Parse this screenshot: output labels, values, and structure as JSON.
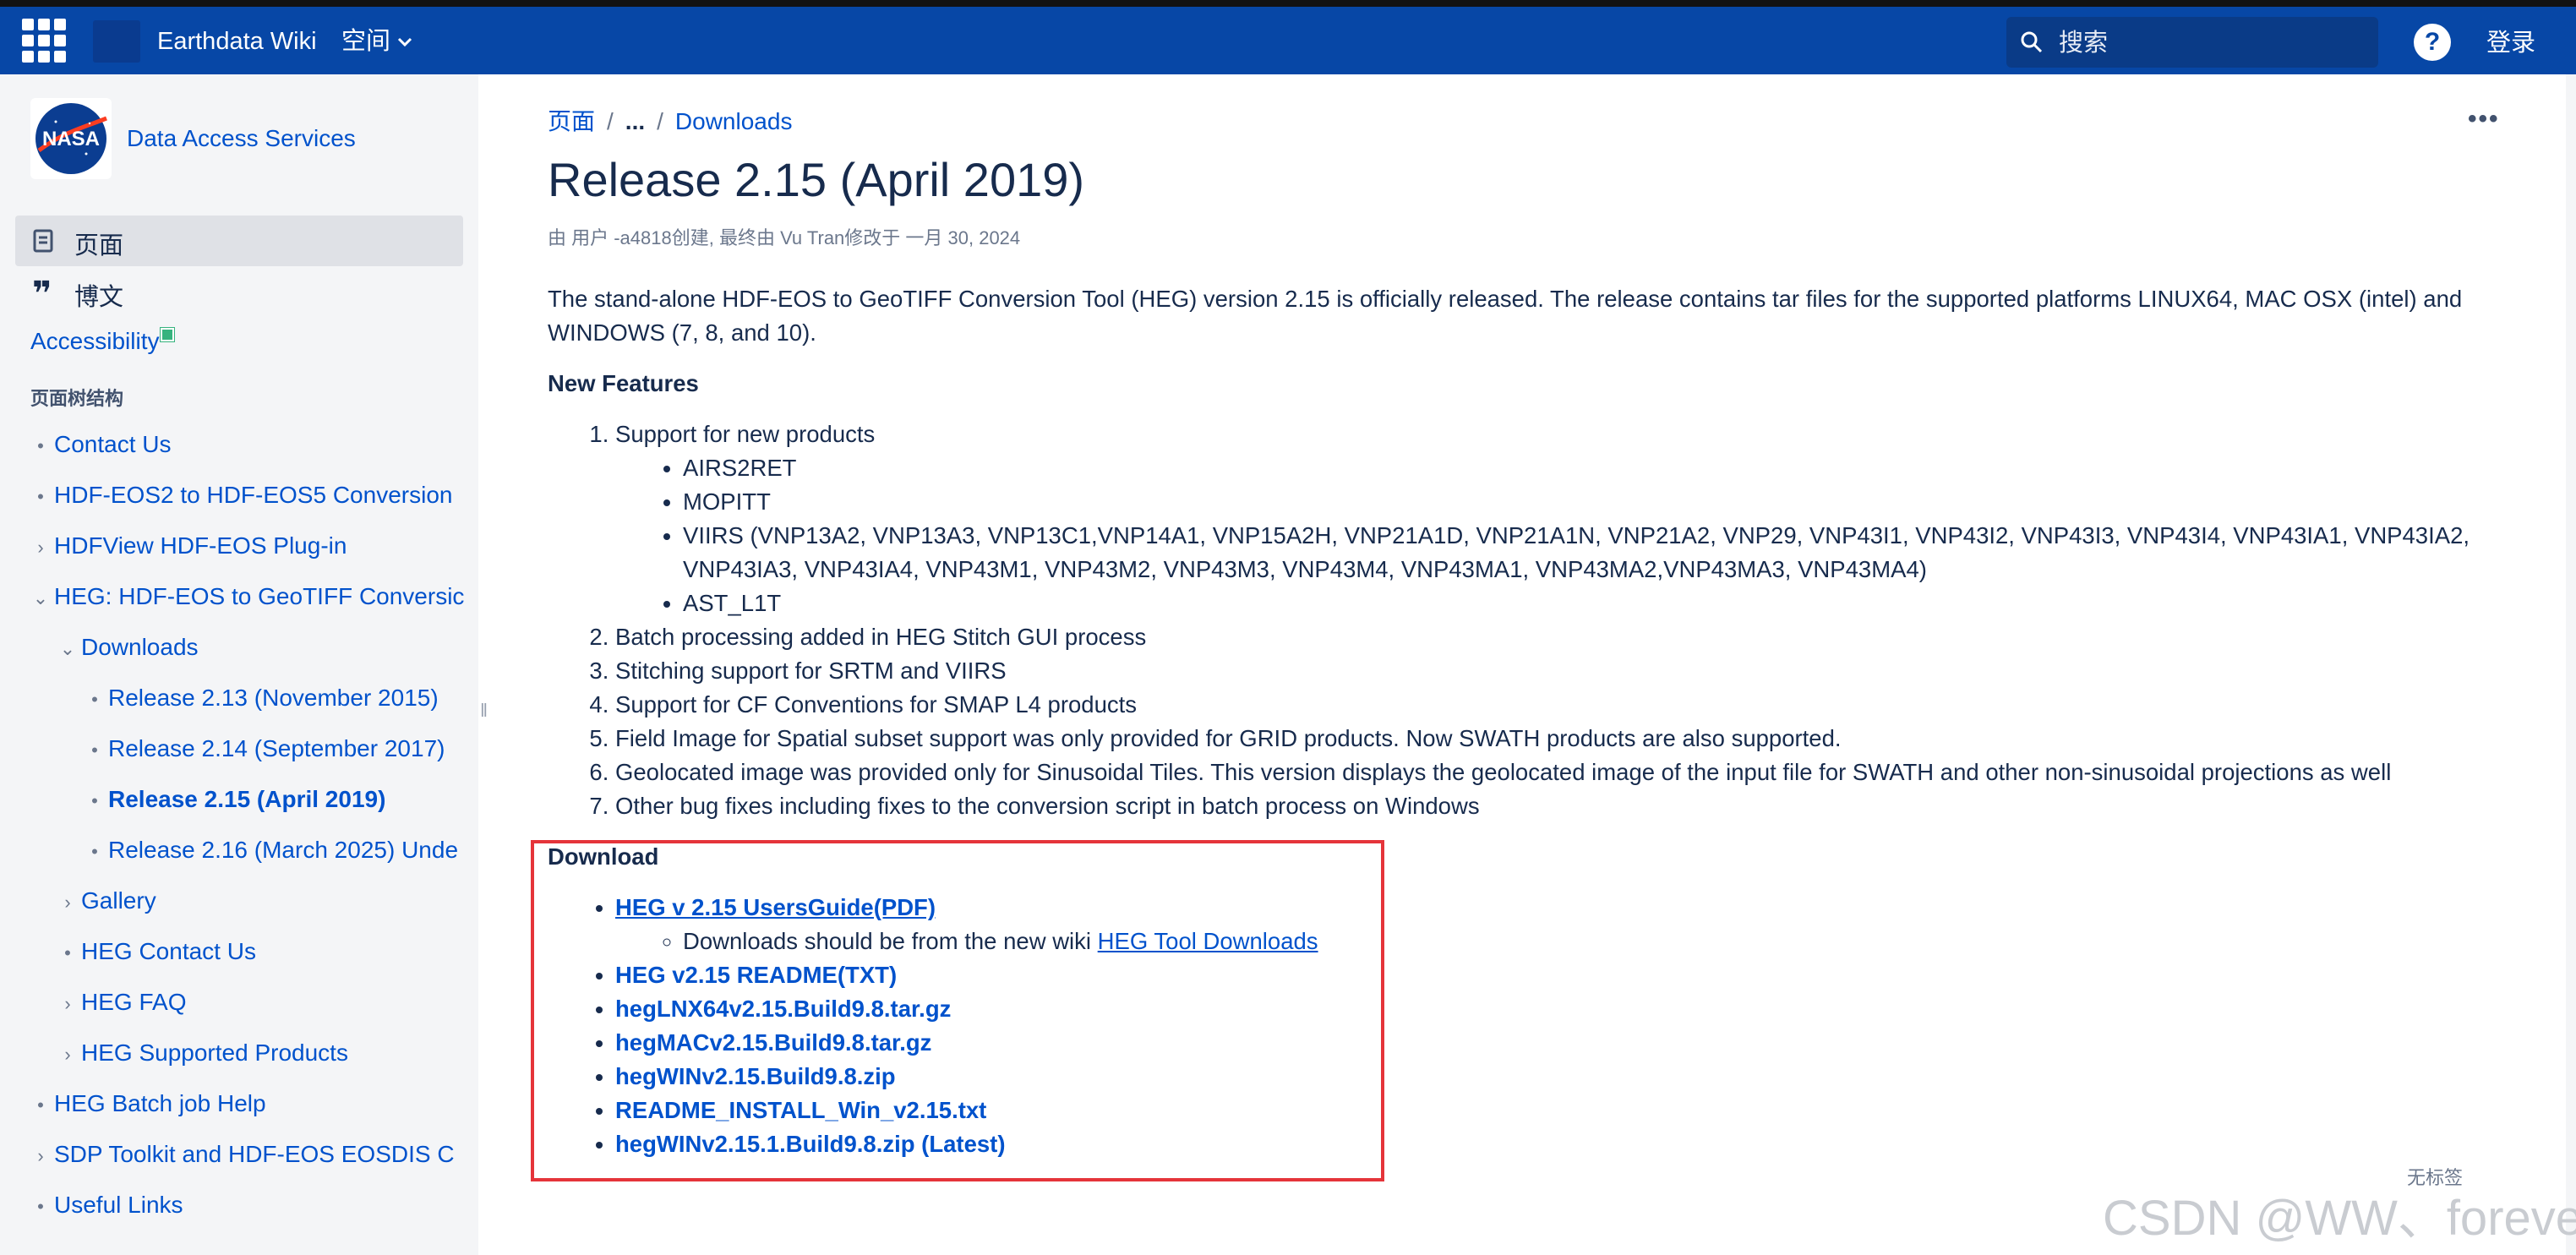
{
  "topbar": {
    "site_name": "Earthdata Wiki",
    "spaces_label": "空间",
    "search_placeholder": "搜索",
    "help_label": "?",
    "login_label": "登录"
  },
  "sidebar": {
    "space_name": "Data Access Services",
    "pages_label": "页面",
    "blog_label": "博文",
    "blog_icon": "❞",
    "accessibility_label": "Accessibility",
    "tree_title": "页面树结构",
    "tree": [
      {
        "label": "Contact Us",
        "marker": "•"
      },
      {
        "label": "HDF-EOS2 to HDF-EOS5 Conversion",
        "marker": "•"
      },
      {
        "label": "HDFView HDF-EOS Plug-in",
        "marker": "›"
      },
      {
        "label": "HEG: HDF-EOS to GeoTIFF Conversic",
        "marker": "⌄"
      },
      {
        "label": "Downloads",
        "marker": "⌄"
      },
      {
        "label": "Release 2.13 (November 2015)",
        "marker": "•"
      },
      {
        "label": "Release 2.14 (September 2017)",
        "marker": "•"
      },
      {
        "label": "Release 2.15 (April 2019)",
        "marker": "•"
      },
      {
        "label": "Release 2.16 (March 2025) Unde",
        "marker": "•"
      },
      {
        "label": "Gallery",
        "marker": "›"
      },
      {
        "label": "HEG Contact Us",
        "marker": "•"
      },
      {
        "label": "HEG FAQ",
        "marker": "›"
      },
      {
        "label": "HEG Supported Products",
        "marker": "›"
      },
      {
        "label": "HEG Batch job Help",
        "marker": "•"
      },
      {
        "label": "SDP Toolkit and HDF-EOS EOSDIS C",
        "marker": "›"
      },
      {
        "label": "Useful Links",
        "marker": "•"
      }
    ]
  },
  "breadcrumb": {
    "root": "页面",
    "ellipsis": "...",
    "parent": "Downloads"
  },
  "page": {
    "title": "Release 2.15 (April 2019)",
    "byline": "由 用户 -a4818创建, 最终由 Vu Tran修改于 一月 30, 2024",
    "intro": "The stand-alone HDF-EOS to GeoTIFF Conversion Tool (HEG) version 2.15 is officially released. The release contains tar files for the supported platforms LINUX64, MAC OSX (intel) and WINDOWS (7, 8, and 10).",
    "new_features_heading": "New Features",
    "features": {
      "item1": "Support for new products",
      "item1_sub": [
        "AIRS2RET",
        "MOPITT",
        "VIIRS (VNP13A2, VNP13A3, VNP13C1,VNP14A1, VNP15A2H, VNP21A1D, VNP21A1N, VNP21A2, VNP29, VNP43I1, VNP43I2, VNP43I3, VNP43I4, VNP43IA1, VNP43IA2, VNP43IA3, VNP43IA4, VNP43M1, VNP43M2, VNP43M3, VNP43M4, VNP43MA1, VNP43MA2,VNP43MA3, VNP43MA4)",
        "AST_L1T"
      ],
      "item2": "Batch processing added in HEG Stitch GUI process",
      "item3": "Stitching support for SRTM and VIIRS",
      "item4": "Support for CF Conventions for SMAP L4 products",
      "item5": "Field Image for Spatial subset support was only provided for GRID products. Now SWATH products are also supported.",
      "item6": "Geolocated image was provided only for Sinusoidal Tiles. This version displays the geolocated image of the input file for SWATH and other non-sinusoidal projections as well",
      "item7": "Other bug fixes including fixes to the conversion script in batch process on Windows"
    },
    "download_heading": "Download",
    "downloads": {
      "guide": "HEG v 2.15 UsersGuide(PDF)",
      "note_text": "Downloads should be from the new wiki ",
      "note_link": "HEG Tool Downloads",
      "readme": "HEG v2.15 README(TXT)",
      "linux": "hegLNX64v2.15.Build9.8.tar.gz",
      "mac": "hegMACv2.15.Build9.8.tar.gz",
      "win": "hegWINv2.15.Build9.8.zip",
      "readme_install": "README_INSTALL_Win_v2.15.txt",
      "win_latest": "hegWINv2.15.1.Build9.8.zip (Latest)"
    },
    "labels_text": "无标签",
    "watermark": "CSDN @WW、forever"
  },
  "colors": {
    "topbar": "#0747a6",
    "link": "#0052cc",
    "highlight_box": "#e5343a",
    "sidebar_bg": "#f4f5f7"
  }
}
